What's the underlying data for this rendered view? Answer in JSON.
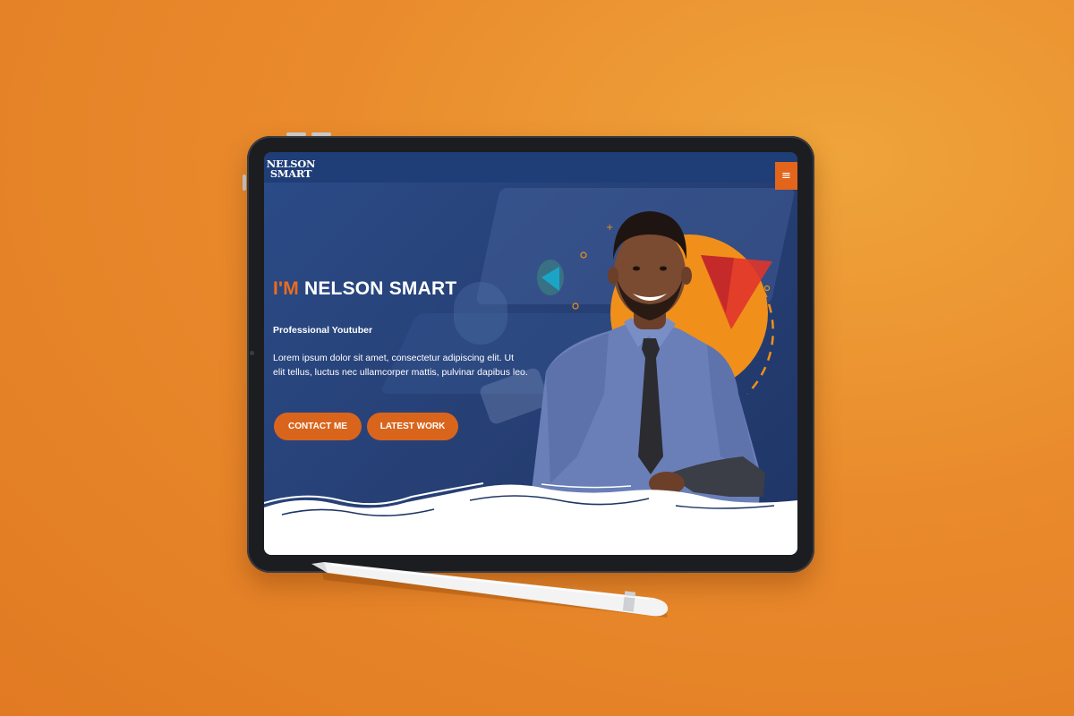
{
  "site": {
    "logo_line1": "NELSON",
    "logo_line2": "SMART"
  },
  "nav": {
    "menu_icon": "hamburger-menu-icon",
    "menu_glyph": "≡"
  },
  "hero": {
    "title_prefix": "I'M",
    "title_name": "NELSON SMART",
    "subtitle": "Professional Youtuber",
    "description": "Lorem ipsum dolor sit amet, consectetur adipiscing elit. Ut elit tellus, luctus nec ullamcorper mattis, pulvinar dapibus leo.",
    "buttons": {
      "contact": "CONTACT ME",
      "work": "LATEST WORK"
    }
  },
  "colors": {
    "background": "#e9892c",
    "screen_bg": "#263f74",
    "accent": "#e3641b",
    "button": "#d9651d",
    "circle": "#f0901a",
    "triangle_red": "#e0352b",
    "triangle_blue": "#1aa5c7"
  }
}
